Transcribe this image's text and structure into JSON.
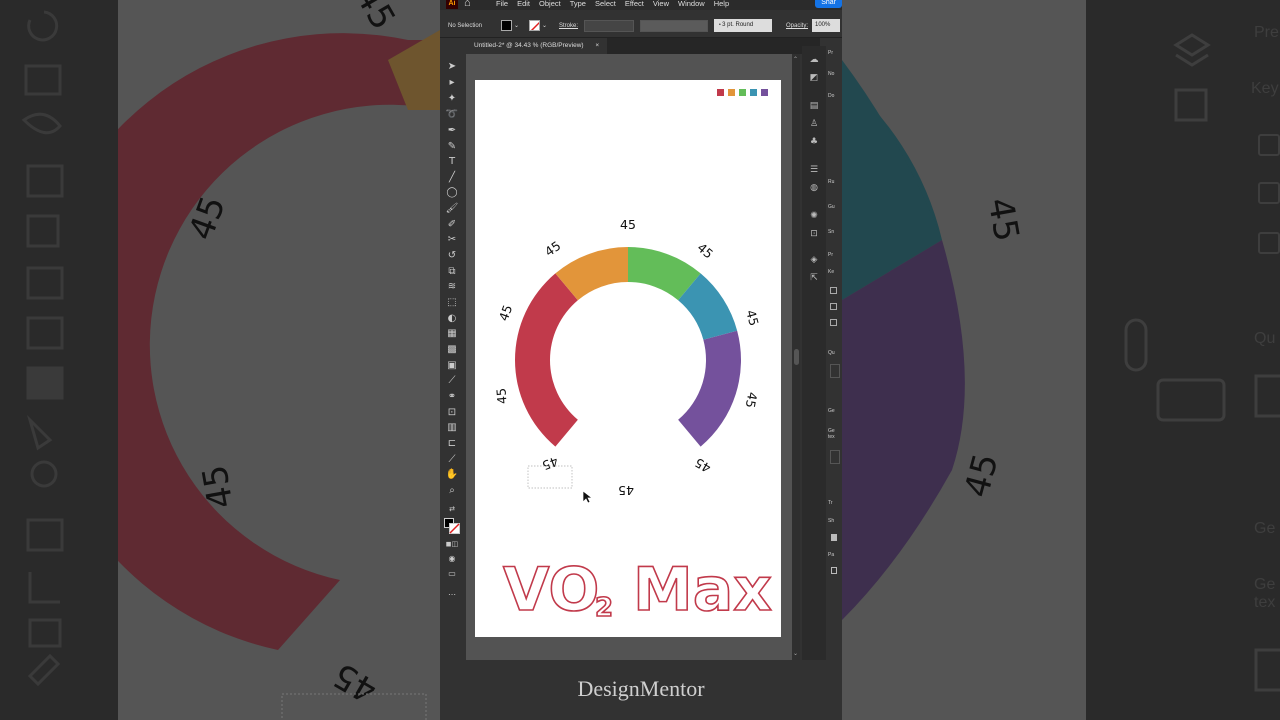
{
  "menubar": {
    "logo": "Ai",
    "items": [
      "File",
      "Edit",
      "Object",
      "Type",
      "Select",
      "Effect",
      "View",
      "Window",
      "Help"
    ],
    "share_label": "Shar"
  },
  "control_bar": {
    "selection": "No Selection",
    "stroke_label": "Stroke:",
    "stroke_profile": "3 pt. Round",
    "opacity_label": "Opacity:",
    "opacity_value": "100%"
  },
  "document_tab": {
    "title": "Untitled-2* @ 34.43 % (RGB/Preview)",
    "close": "×"
  },
  "artwork": {
    "gauge_labels": [
      "45",
      "45",
      "45",
      "45",
      "45",
      "45",
      "45",
      "45",
      "45"
    ],
    "stray_label": "45",
    "title_main": "VO",
    "title_sub": "2",
    "title_end": "Max",
    "colors": {
      "red": "#c13a4b",
      "orange": "#e2953a",
      "green": "#63bd59",
      "teal": "#3b94b2",
      "purple": "#74519c",
      "title_stroke": "#c13a4b"
    }
  },
  "properties_panel": {
    "labels": [
      "Pr",
      "No",
      "Do",
      "Ru",
      "Gu",
      "Sn",
      "Pr",
      "Ke",
      "Qu",
      "Ge",
      "Ge tex",
      "Tr",
      "Sh",
      "Pa"
    ]
  },
  "background_right_panel": {
    "labels": [
      "Pre",
      "Key",
      "Qu",
      "Ge",
      "Ge tex"
    ]
  },
  "background_art_labels": [
    "45",
    "45",
    "45",
    "45",
    "45",
    "45"
  ],
  "footer": {
    "brand": "DesignMentor"
  }
}
